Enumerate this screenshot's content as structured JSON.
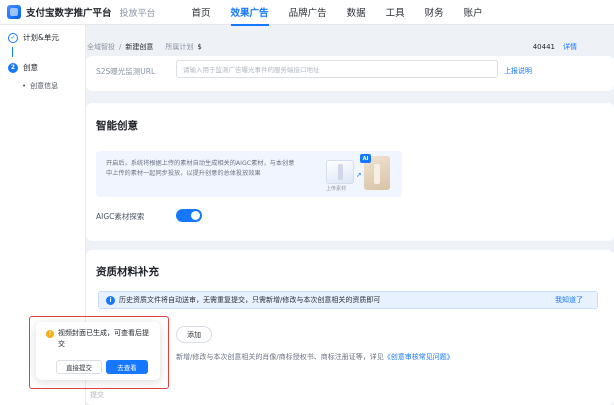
{
  "header": {
    "brand": "支付宝数字推广平台",
    "sub_brand": "投放平台",
    "nav": [
      {
        "label": "首页"
      },
      {
        "label": "效果广告",
        "active": true
      },
      {
        "label": "品牌广告"
      },
      {
        "label": "数据"
      },
      {
        "label": "工具"
      },
      {
        "label": "财务"
      },
      {
        "label": "账户"
      }
    ]
  },
  "sidebar": {
    "steps": [
      {
        "index": "✓",
        "label": "计划&单元",
        "state": "done"
      },
      {
        "index": "2",
        "label": "创意",
        "state": "current"
      }
    ],
    "substep": "创意信息"
  },
  "breadcrumb": {
    "root": "全域智投",
    "separator": "/",
    "current": "新建创意",
    "plan_label": "所属计划",
    "plan_value": "$",
    "plan_id": "40441",
    "detail_link": "详情"
  },
  "url_field": {
    "label": "S2S曝光监测URL",
    "placeholder": "请输入用于监测广告曝光事件的服务端接口地址",
    "help_link": "上报说明"
  },
  "smart_creative": {
    "title": "智能创意",
    "description": "开启后，系统将根据上传的素材自动生成相关的AIGC素材，与本创意中上传的素材一起同步投放，以提升创意的总体投放效果",
    "ai_badge": "AI",
    "upload_caption": "上传素材",
    "toggle_label": "AIGC素材探索",
    "toggle_on": true
  },
  "qualification": {
    "title": "资质材料补充",
    "alert_text": "历史资质文件将自动送审，无需重复提交，只需新增/修改与本次创意相关的资质即可",
    "alert_link": "我知道了",
    "add_button": "添加",
    "hint_prefix": "新增/修改与本次创意相关的肖像/商标授权书、商标注册证等，详见",
    "hint_link": "《创意审核常见问题》",
    "submit_label": "提交"
  },
  "popover": {
    "message": "视频封面已生成，可查看后提交",
    "secondary_button": "直接提交",
    "primary_button": "去查看"
  },
  "colors": {
    "primary": "#1677ff",
    "highlight": "#e0443d",
    "warning": "#faad14"
  }
}
